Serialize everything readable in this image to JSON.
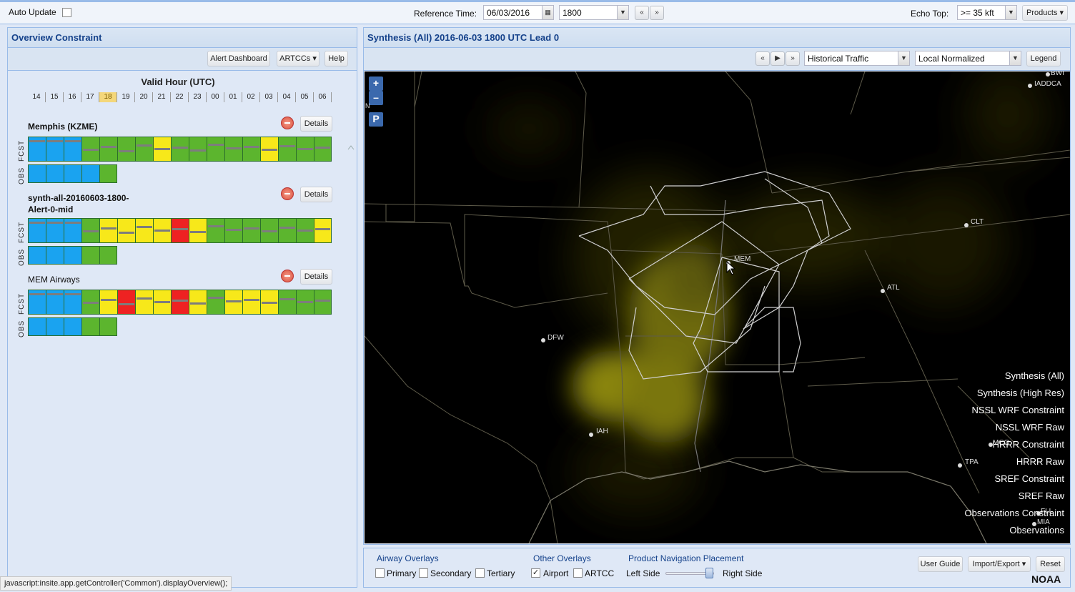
{
  "toolbar": {
    "auto_update_label": "Auto Update",
    "reference_time_label": "Reference Time:",
    "date_value": "06/03/2016",
    "time_value": "1800",
    "echo_top_label": "Echo Top:",
    "echo_top_value": ">= 35 kft",
    "products_label": "Products"
  },
  "left_panel": {
    "title": "Overview Constraint",
    "buttons": {
      "alert_dashboard": "Alert Dashboard",
      "artccs": "ARTCCs",
      "help": "Help"
    },
    "valid_hour_label": "Valid Hour (UTC)",
    "hours": [
      "14",
      "15",
      "16",
      "17",
      "18",
      "19",
      "20",
      "21",
      "22",
      "23",
      "00",
      "01",
      "02",
      "03",
      "04",
      "05",
      "06"
    ],
    "selected_hour": "18",
    "fcst_label": "FCST",
    "obs_label": "OBS",
    "details_label": "Details",
    "colors": {
      "blue": "#1aa3f0",
      "green": "#5cb52e",
      "yellow": "#f7e81a",
      "red": "#ee2222"
    },
    "groups": [
      {
        "name": "Memphis (KZME)",
        "fcst": [
          "blue",
          "blue",
          "blue",
          "green",
          "green",
          "green",
          "green",
          "yellow",
          "green",
          "green",
          "green",
          "green",
          "green",
          "yellow",
          "green",
          "green",
          "green"
        ],
        "obs": [
          "blue",
          "blue",
          "blue",
          "blue",
          "green"
        ]
      },
      {
        "name": "synth-all-20160603-1800-Alert-0-mid",
        "name_line1": "synth-all-20160603-1800-",
        "name_line2": "Alert-0-mid",
        "fcst": [
          "blue",
          "blue",
          "blue",
          "green",
          "yellow",
          "yellow",
          "yellow",
          "yellow",
          "red",
          "yellow",
          "green",
          "green",
          "green",
          "green",
          "green",
          "green",
          "yellow"
        ],
        "obs": [
          "blue",
          "blue",
          "blue",
          "green",
          "green"
        ]
      },
      {
        "name": "MEM Airways",
        "fcst": [
          "blue",
          "blue",
          "blue",
          "green",
          "yellow",
          "red",
          "yellow",
          "yellow",
          "red",
          "yellow",
          "green",
          "yellow",
          "yellow",
          "yellow",
          "green",
          "green",
          "green"
        ],
        "obs": [
          "blue",
          "blue",
          "blue",
          "green",
          "green"
        ]
      }
    ]
  },
  "right_panel": {
    "title": "Synthesis (All) 2016-06-03 1800 UTC Lead 0",
    "traffic_select": "Historical Traffic",
    "normalize_select": "Local Normalized",
    "legend_button": "Legend",
    "map_labels": {
      "mem": "MEM",
      "dfw": "DFW",
      "iah": "IAH",
      "atl": "ATL",
      "clt": "CLT",
      "tpa": "TPA",
      "mia": "MIA",
      "iad_dca": "IADDCA",
      "bwi": "BWI",
      "fll": "FLL",
      "mco": "MCO",
      "north": "N",
      "p_button": "P",
      "zoom_in": "+",
      "zoom_out": "–"
    },
    "products": [
      "Synthesis (All)",
      "Synthesis (High Res)",
      "NSSL WRF Constraint",
      "NSSL WRF Raw",
      "HRRR Constraint",
      "HRRR Raw",
      "SREF Constraint",
      "SREF Raw",
      "Observations Constraint",
      "Observations"
    ]
  },
  "bottom_panel": {
    "airway_overlays": "Airway Overlays",
    "other_overlays": "Other Overlays",
    "nav_placement": "Product Navigation Placement",
    "primary": "Primary",
    "secondary": "Secondary",
    "tertiary": "Tertiary",
    "airport": "Airport",
    "artcc": "ARTCC",
    "left_side": "Left Side",
    "right_side": "Right Side",
    "user_guide": "User Guide",
    "import_export": "Import/Export",
    "reset": "Reset",
    "noaa": "NOAA"
  },
  "status_text": "javascript:insite.app.getController('Common').displayOverview();"
}
